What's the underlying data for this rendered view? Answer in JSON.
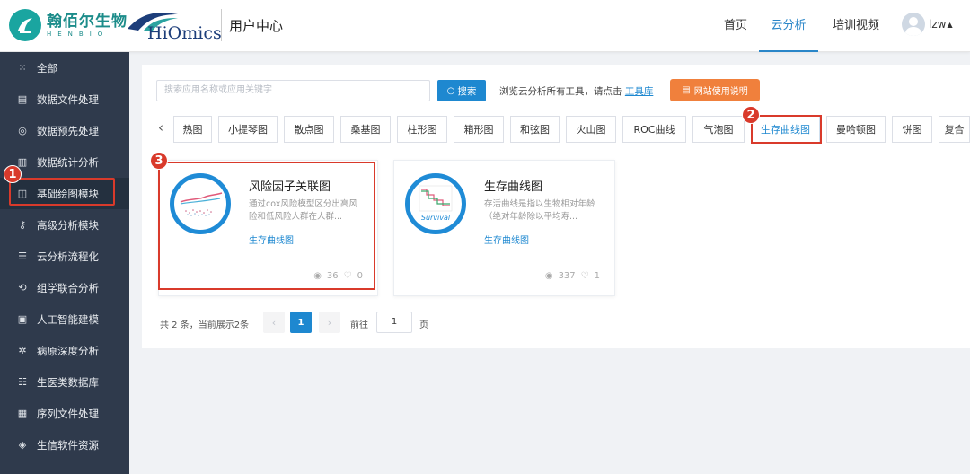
{
  "header": {
    "logo_cn": "翰佰尔生物",
    "logo_en": "HENBIO",
    "brand": "HiOmics",
    "section_title": "用户中心",
    "nav": [
      "首页",
      "云分析",
      "培训视频"
    ],
    "active_nav": "云分析",
    "username": "lzw"
  },
  "sidebar": {
    "items": [
      {
        "label": "全部",
        "icon": "grid-icon"
      },
      {
        "label": "数据文件处理",
        "icon": "file-icon"
      },
      {
        "label": "数据预先处理",
        "icon": "target-icon"
      },
      {
        "label": "数据统计分析",
        "icon": "bar-chart-icon"
      },
      {
        "label": "基础绘图模块",
        "icon": "chart-icon"
      },
      {
        "label": "高级分析模块",
        "icon": "key-icon"
      },
      {
        "label": "云分析流程化",
        "icon": "flow-icon"
      },
      {
        "label": "组学联合分析",
        "icon": "loop-icon"
      },
      {
        "label": "人工智能建模",
        "icon": "chip-icon"
      },
      {
        "label": "病原深度分析",
        "icon": "virus-icon"
      },
      {
        "label": "生医类数据库",
        "icon": "database-icon"
      },
      {
        "label": "序列文件处理",
        "icon": "doc-icon"
      },
      {
        "label": "生信软件资源",
        "icon": "package-icon"
      }
    ],
    "active_index": 4
  },
  "search": {
    "placeholder": "搜索应用名称或应用关键字",
    "button_label": "搜索",
    "browse_text": "浏览云分析所有工具，请点击",
    "toolbox_link": "工具库",
    "guide_button": "网站使用说明"
  },
  "tabs": [
    "热图",
    "小提琴图",
    "散点图",
    "桑基图",
    "柱形图",
    "箱形图",
    "和弦图",
    "火山图",
    "ROC曲线",
    "气泡图",
    "生存曲线图",
    "曼哈顿图",
    "饼图",
    "复合"
  ],
  "active_tab": "生存曲线图",
  "cards": [
    {
      "title": "风险因子关联图",
      "desc": "通过cox风险模型区分出高风险和低风险人群在人群...",
      "tag": "生存曲线图",
      "views": "36",
      "likes": "0"
    },
    {
      "title": "生存曲线图",
      "desc": "存活曲线是指以生物相对年龄（绝对年龄除以平均寿...",
      "tag": "生存曲线图",
      "views": "337",
      "likes": "1",
      "icon_text": "Survival"
    }
  ],
  "pager": {
    "total_text": "共 2 条，当前展示2条",
    "current_page": "1",
    "goto_label": "前往",
    "goto_value": "1",
    "page_suffix": "页"
  },
  "annotations": [
    "1",
    "2",
    "3"
  ],
  "colors": {
    "accent": "#1e88d0",
    "sidebar": "#2f3a4c",
    "annotation": "#d93a2b",
    "guide": "#f0803c"
  }
}
